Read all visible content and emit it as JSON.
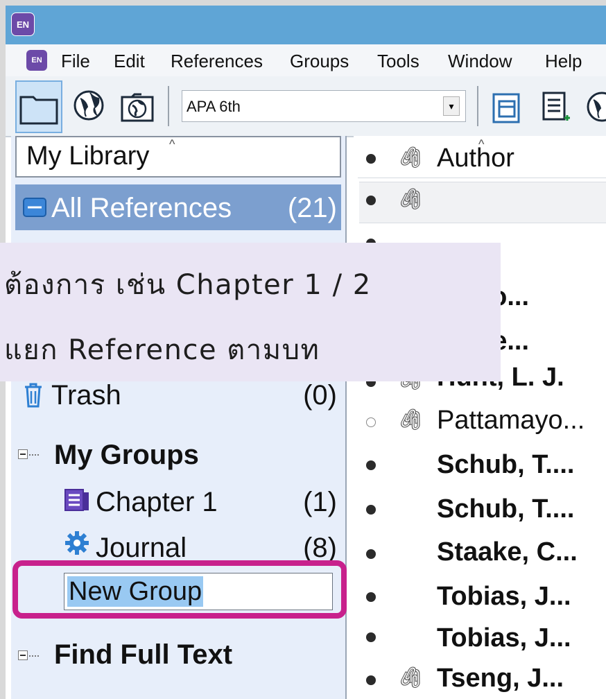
{
  "app": {
    "logo_text": "EN"
  },
  "menu": {
    "icon_text": "EN",
    "items": [
      "File",
      "Edit",
      "References",
      "Groups",
      "Tools",
      "Window",
      "Help"
    ]
  },
  "toolbar": {
    "style_value": "APA 6th",
    "icons": [
      "local-library-icon",
      "online-search-icon",
      "integrated-library-icon",
      "copy-icon",
      "insert-citation-icon",
      "online-icon"
    ]
  },
  "library": {
    "header": "My Library",
    "all_references": {
      "label": "All References",
      "count": "(21)"
    },
    "trash": {
      "label": "Trash",
      "count": "(0)"
    },
    "my_groups": {
      "label": "My Groups",
      "items": [
        {
          "label": "Chapter 1",
          "count": "(1)"
        },
        {
          "label": "Journal",
          "count": "(8)"
        }
      ],
      "new_group_value": "New Group"
    },
    "find_full_text": "Find Full Text"
  },
  "references": {
    "column_header": "Author",
    "rows": [
      {
        "author": ""
      },
      {
        "author": ""
      },
      {
        "author": "nymo..."
      },
      {
        "author": "npste..."
      },
      {
        "author": "Hunt, L. J."
      },
      {
        "author": "Pattamayo..."
      },
      {
        "author": "Schub, T...."
      },
      {
        "author": "Schub, T...."
      },
      {
        "author": "Staake, C..."
      },
      {
        "author": "Tobias, J..."
      },
      {
        "author": "Tobias, J..."
      },
      {
        "author": "Tseng, J..."
      }
    ]
  },
  "overlay": {
    "line1": "ต้องการ เช่น Chapter 1 / 2",
    "line2": "แยก Reference ตามบท"
  },
  "colors": {
    "titlebar": "#5fa5d6",
    "selected_row": "#7c9fcf",
    "highlight": "#c8218c",
    "overlay_bg": "#eae5f4"
  }
}
